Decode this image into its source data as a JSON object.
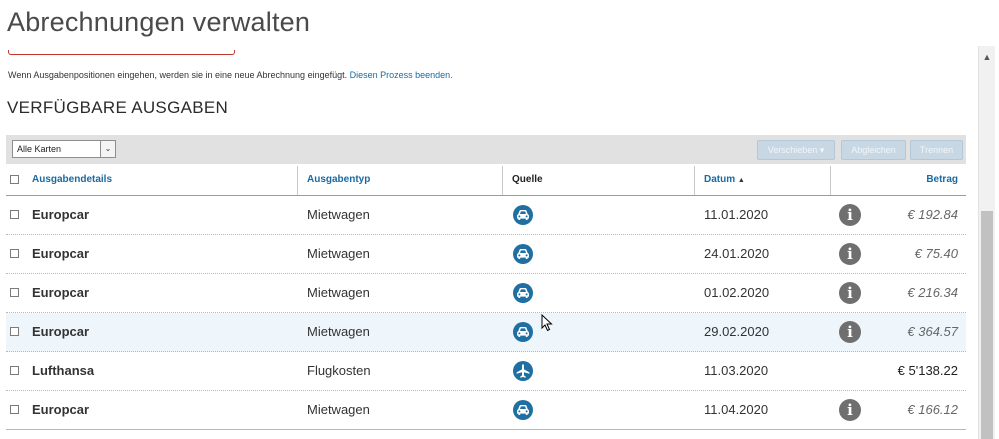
{
  "page": {
    "title": "Abrechnungen verwalten",
    "info_text": "Wenn Ausgabenpositionen eingehen, werden sie in eine neue Abrechnung eingefügt.",
    "info_link": "Diesen Prozess beenden.",
    "section_title": "VERFÜGBARE AUSGABEN"
  },
  "toolbar": {
    "filter_value": "Alle Karten",
    "move_label": "Verschieben ▾",
    "match_label": "Abgleichen",
    "split_label": "Trennen"
  },
  "table": {
    "headers": {
      "details": "Ausgabendetails",
      "type": "Ausgabentyp",
      "source": "Quelle",
      "date": "Datum",
      "sort_indicator": "▲",
      "amount": "Betrag"
    },
    "rows": [
      {
        "merchant": "Europcar",
        "type": "Mietwagen",
        "source_icon": "car-icon",
        "date": "11.01.2020",
        "info": "i",
        "amount": "€ 192.84"
      },
      {
        "merchant": "Europcar",
        "type": "Mietwagen",
        "source_icon": "car-icon",
        "date": "24.01.2020",
        "info": "i",
        "amount": "€ 75.40"
      },
      {
        "merchant": "Europcar",
        "type": "Mietwagen",
        "source_icon": "car-icon",
        "date": "01.02.2020",
        "info": "i",
        "amount": "€ 216.34"
      },
      {
        "merchant": "Europcar",
        "type": "Mietwagen",
        "source_icon": "car-icon",
        "date": "29.02.2020",
        "info": "i",
        "amount": "€ 364.57"
      },
      {
        "merchant": "Lufthansa",
        "type": "Flugkosten",
        "source_icon": "plane-icon",
        "date": "11.03.2020",
        "info": "",
        "amount": "€ 5'138.22"
      },
      {
        "merchant": "Europcar",
        "type": "Mietwagen",
        "source_icon": "car-icon",
        "date": "11.04.2020",
        "info": "i",
        "amount": "€ 166.12"
      }
    ]
  },
  "colors": {
    "link": "#1a6aa0",
    "source_icon_bg": "#1f6fa3",
    "title_underline": "#c0392b",
    "hover_row": "#eef6fb"
  }
}
